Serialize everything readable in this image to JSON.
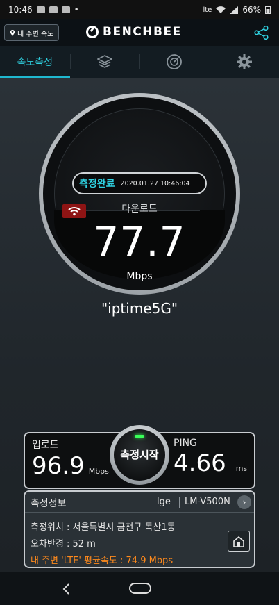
{
  "status_bar": {
    "time": "10:46",
    "carrier": "lte",
    "battery": "66%"
  },
  "header": {
    "nearby_button": "내 주변 속도",
    "logo_text": "BENCHBEE"
  },
  "tabs": [
    {
      "label": "속도측정",
      "icon": "speed-test",
      "active": true
    },
    {
      "label": "",
      "icon": "layers-icon",
      "active": false
    },
    {
      "label": "",
      "icon": "chart-icon",
      "active": false
    },
    {
      "label": "",
      "icon": "gear-icon",
      "active": false
    }
  ],
  "gauge": {
    "status": "측정완료",
    "timestamp": "2020.01.27 10:46:04",
    "label": "다운로드",
    "value": "77.7",
    "unit": "Mbps",
    "ssid": "\"iptime5G\""
  },
  "results": {
    "upload_label": "업로드",
    "upload_value": "96.9",
    "upload_unit": "Mbps",
    "start_label": "측정시작",
    "ping_label": "PING",
    "ping_value": "4.66",
    "ping_unit": "ms"
  },
  "info": {
    "title": "측정정보",
    "carrier": "lge",
    "device": "LM-V500N",
    "location": "측정위치 : 서울특별시 금천구 독산1동",
    "error_radius": "오차반경 : 52 m",
    "average": "내 주변 'LTE' 평균속도 :  74.9 Mbps"
  },
  "colors": {
    "accent": "#2fd0e0",
    "orange": "#ff8a1c",
    "wifi_badge": "#8e1414"
  }
}
